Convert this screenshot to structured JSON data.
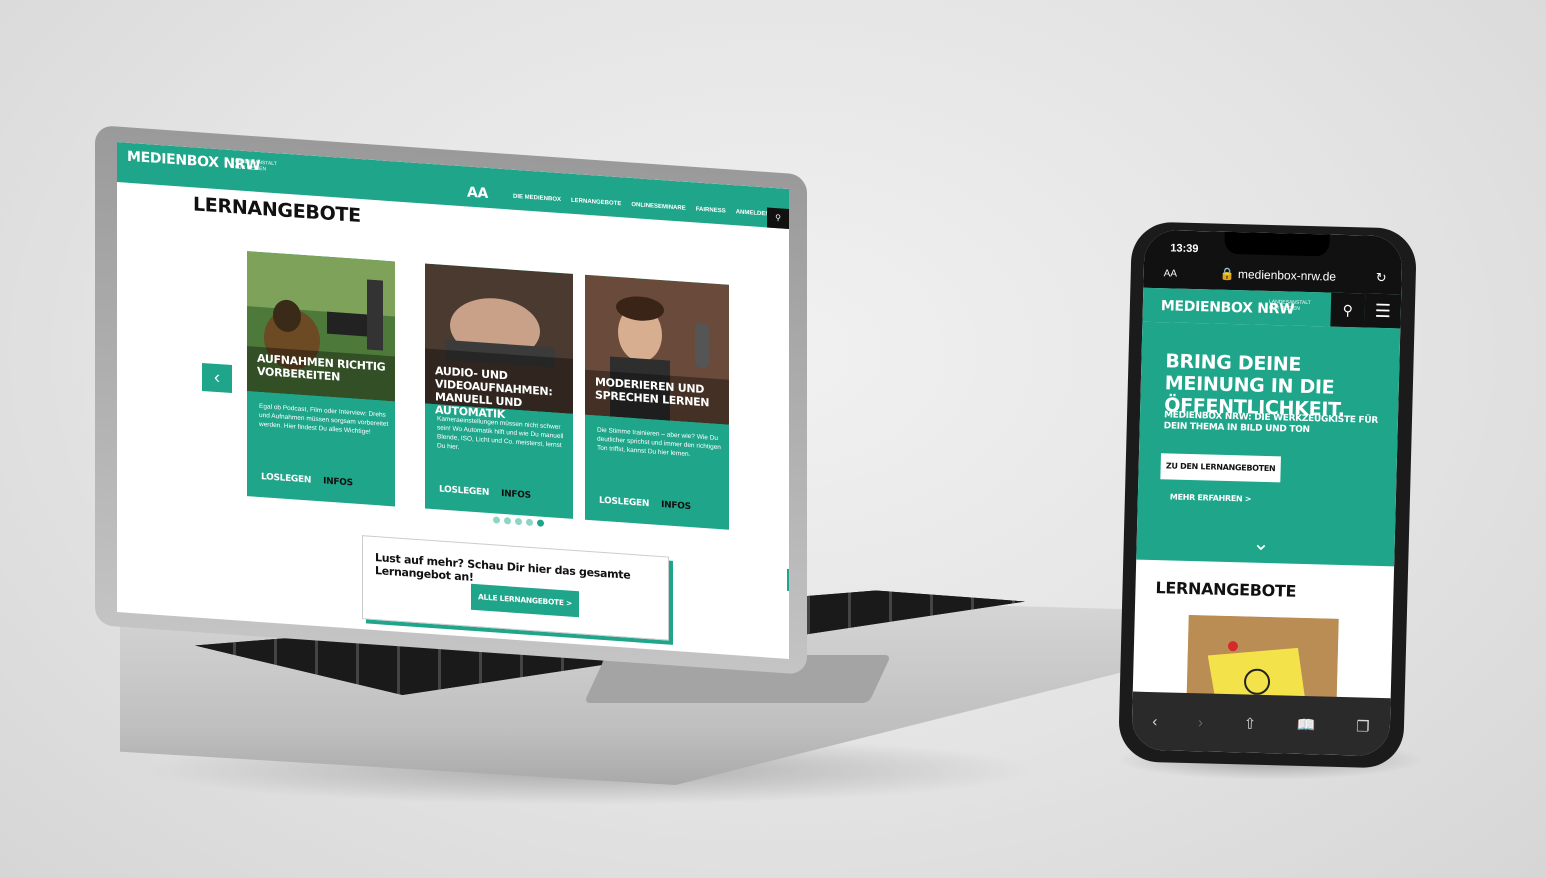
{
  "laptop_site": {
    "logo": "MEDIENBOX NRW",
    "logo_sub": "LANDESANSTALT FÜR MEDIEN",
    "aa": "AA",
    "nav": [
      "DIE MEDIENBOX",
      "LERNANGEBOTE",
      "ONLINESEMINARE",
      "FAIRNESS",
      "ANMELDEN"
    ],
    "title": "LERNANGEBOTE",
    "cards": [
      {
        "title": "AUFNAHMEN RICHTIG VORBEREITEN",
        "text": "Egal ob Podcast, Film oder Interview: Drehs und Aufnahmen müssen sorgsam vorbereitet werden. Hier findest Du alles Wichtige!",
        "primary": "LOSLEGEN",
        "secondary": "INFOS"
      },
      {
        "title": "AUDIO- UND VIDEOAUFNAHMEN: MANUELL UND AUTOMATIK",
        "text": "Kameraeinstellungen müssen nicht schwer sein! Wo Automatik hilft und wie Du manuell Blende, ISO, Licht und Co. meisterst, lernst Du hier.",
        "primary": "LOSLEGEN",
        "secondary": "INFOS"
      },
      {
        "title": "MODERIEREN UND SPRECHEN LERNEN",
        "text": "Die Stimme trainieren – aber wie? Wie Du deutlicher sprichst und immer den richtigen Ton triffst, kannst Du hier lernen.",
        "primary": "LOSLEGEN",
        "secondary": "INFOS"
      }
    ],
    "more_text": "Lust auf mehr? Schau Dir hier das gesamte Lernangebot an!",
    "more_button": "ALLE LERNANGEBOTE >"
  },
  "phone_site": {
    "time": "13:39",
    "aa": "AA",
    "url": "medienbox-nrw.de",
    "logo": "MEDIENBOX NRW",
    "logo_sub": "LANDESANSTALT FÜR MEDIEN",
    "headline": "BRING DEINE MEINUNG IN DIE ÖFFENTLICHKEIT.",
    "subline": "MEDIENBOX NRW: DIE WERKZEUGKISTE FÜR DEIN THEMA IN BILD UND TON",
    "cta": "ZU DEN LERNANGEBOTEN",
    "more": "MEHR ERFAHREN >",
    "section_title": "LERNANGEBOTE"
  },
  "colors": {
    "brand_teal": "#1fa58a",
    "dark": "#111111"
  },
  "icons": {
    "search": "search-icon",
    "menu": "hamburger-menu-icon",
    "prev": "chevron-left-icon",
    "up": "chevron-up-icon",
    "down": "chevron-down-icon"
  }
}
